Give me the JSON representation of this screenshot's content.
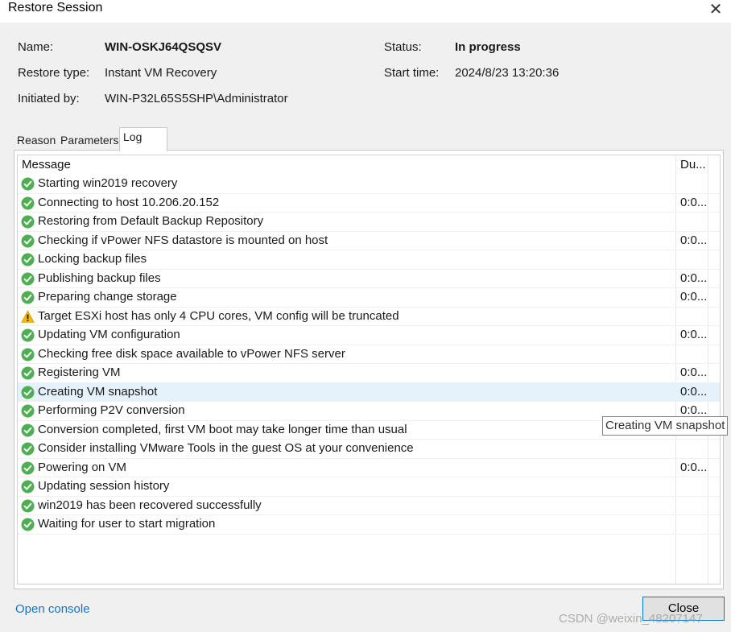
{
  "window": {
    "title": "Restore Session"
  },
  "info": {
    "name_label": "Name:",
    "name_value": "WIN-OSKJ64QSQSV",
    "type_label": "Restore type:",
    "type_value": "Instant VM Recovery",
    "initiated_label": "Initiated by:",
    "initiated_value": "WIN-P32L65S5SHP\\Administrator",
    "status_label": "Status:",
    "status_value": "In progress",
    "start_label": "Start time:",
    "start_value": "2024/8/23 13:20:36"
  },
  "tabs": [
    {
      "label": "Reason"
    },
    {
      "label": "Parameters"
    },
    {
      "label": "Log"
    }
  ],
  "log": {
    "col_message": "Message",
    "col_duration": "Du...",
    "rows": [
      {
        "icon": "check-icon",
        "message": "Starting win2019 recovery",
        "duration": ""
      },
      {
        "icon": "check-icon",
        "message": "Connecting to host 10.206.20.152",
        "duration": "0:0..."
      },
      {
        "icon": "check-icon",
        "message": "Restoring from Default Backup Repository",
        "duration": ""
      },
      {
        "icon": "check-icon",
        "message": "Checking if vPower NFS datastore is mounted on host",
        "duration": "0:0..."
      },
      {
        "icon": "check-icon",
        "message": "Locking backup files",
        "duration": ""
      },
      {
        "icon": "check-icon",
        "message": "Publishing backup files",
        "duration": "0:0..."
      },
      {
        "icon": "check-icon",
        "message": "Preparing change storage",
        "duration": "0:0..."
      },
      {
        "icon": "warning-icon",
        "message": "Target ESXi host has only 4 CPU cores, VM config will be truncated",
        "duration": ""
      },
      {
        "icon": "check-icon",
        "message": "Updating VM configuration",
        "duration": "0:0..."
      },
      {
        "icon": "check-icon",
        "message": "Checking free disk space available to vPower NFS server",
        "duration": ""
      },
      {
        "icon": "check-icon",
        "message": "Registering VM",
        "duration": "0:0..."
      },
      {
        "icon": "check-icon",
        "message": "Creating VM snapshot",
        "duration": "0:0..."
      },
      {
        "icon": "check-icon",
        "message": "Performing P2V conversion",
        "duration": "0:0..."
      },
      {
        "icon": "check-icon",
        "message": "Conversion completed, first VM boot may take longer time than usual",
        "duration": ""
      },
      {
        "icon": "check-icon",
        "message": "Consider installing VMware Tools in the guest OS at your convenience",
        "duration": ""
      },
      {
        "icon": "check-icon",
        "message": "Powering on VM",
        "duration": "0:0..."
      },
      {
        "icon": "check-icon",
        "message": "Updating session history",
        "duration": ""
      },
      {
        "icon": "check-icon",
        "message": "win2019 has been recovered successfully",
        "duration": ""
      },
      {
        "icon": "check-icon",
        "message": "Waiting for user to start migration",
        "duration": ""
      }
    ],
    "tooltip": "Creating VM snapshot"
  },
  "footer": {
    "open_console": "Open console",
    "close_label": "Close",
    "watermark": "CSDN @weixin_48207147"
  },
  "colors": {
    "success": "#4caf50",
    "warning": "#f5b800",
    "link": "#1a73c8",
    "selected_row": "#e5f1fb",
    "button_border": "#0078d7"
  }
}
